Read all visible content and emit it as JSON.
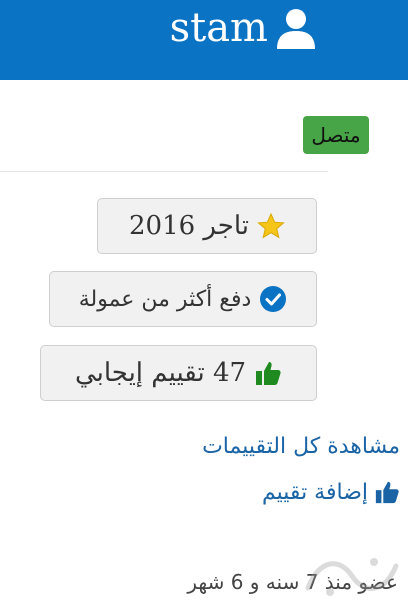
{
  "header": {
    "username": "stam",
    "icon": "user-icon"
  },
  "status": {
    "label": "متصل",
    "color": "#47a447"
  },
  "badges": [
    {
      "label": "تاجر 2016",
      "icon": "star-icon"
    },
    {
      "label": "دفع أكثر من عمولة",
      "icon": "check-circle-icon"
    },
    {
      "label": "47 تقييم إيجابي",
      "icon": "thumbs-up-icon"
    }
  ],
  "links": {
    "view_all": "مشاهدة كل التقييمات",
    "add_rating": "إضافة تقييم",
    "add_rating_icon": "thumbs-up-icon"
  },
  "member_since": "عضو منذ 7 سنه و 6 شهر",
  "colors": {
    "header": "#0b73c4",
    "link": "#1a64a6",
    "icon_green": "#1f8a1f",
    "icon_blue": "#0b73c4",
    "star": "#f5c518"
  }
}
